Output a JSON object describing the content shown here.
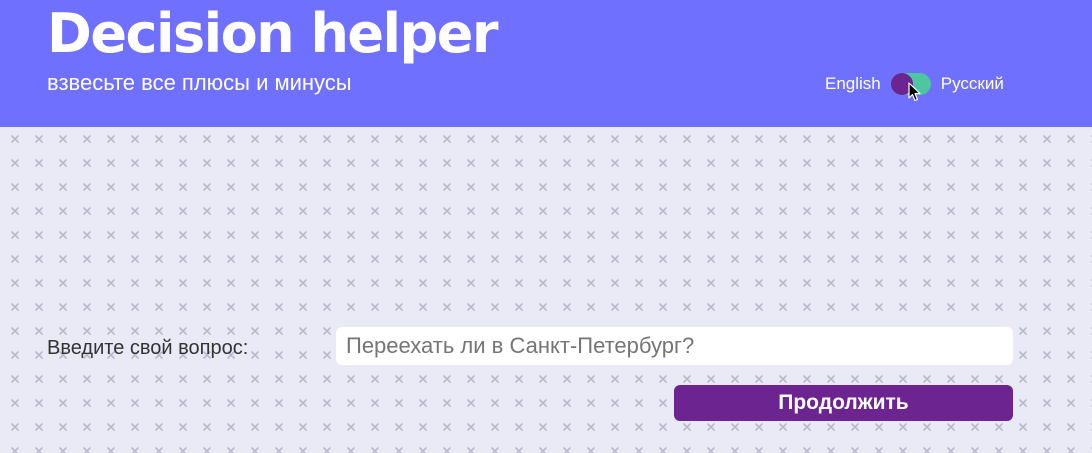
{
  "header": {
    "title": "Decision helper",
    "subtitle": "взвесьте все плюсы и минусы"
  },
  "language_switch": {
    "left_label": "English",
    "right_label": "Русский",
    "track_color": "#4ec6a0",
    "knob_color": "#6c2491"
  },
  "form": {
    "question_label": "Введите свой вопрос:",
    "question_placeholder": "Переехать ли в Санкт-Петербург?",
    "question_value": "",
    "submit_label": "Продолжить"
  },
  "colors": {
    "header_bg": "#7070ff",
    "page_bg": "#e9eaf5",
    "button_bg": "#6c2491"
  }
}
